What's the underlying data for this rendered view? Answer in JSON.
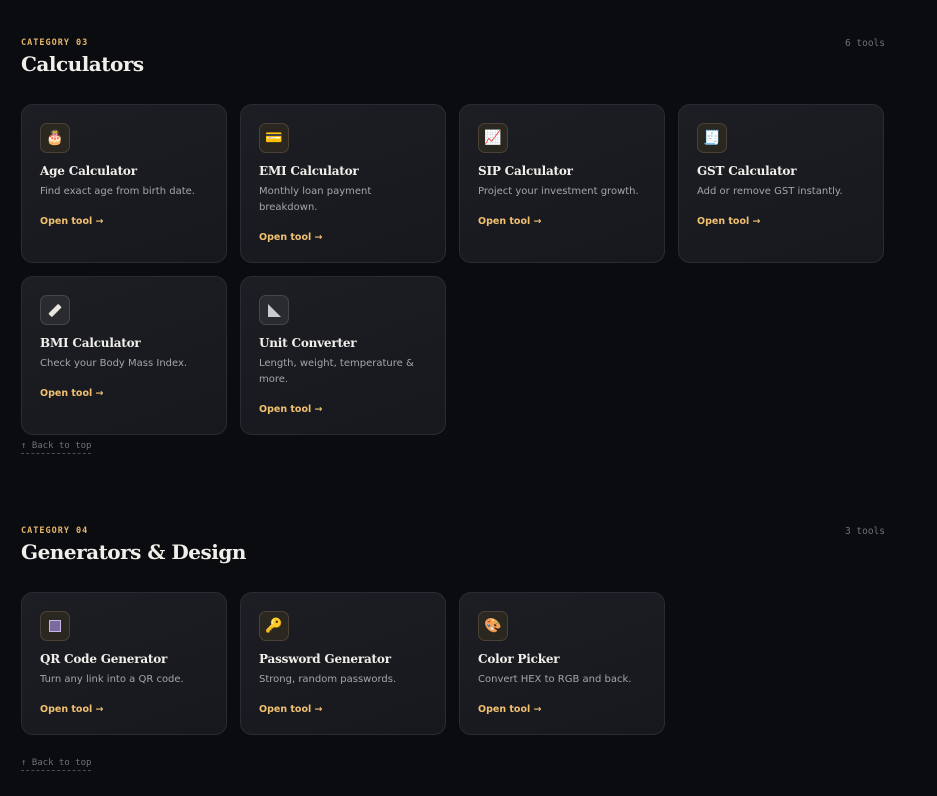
{
  "sections": [
    {
      "category": "CATEGORY 03",
      "count": "6 tools",
      "title": "Calculators",
      "back_label": "↑ Back to top",
      "cards": [
        {
          "title": "Age Calculator",
          "desc": "Find exact age from birth date.",
          "link": "Open tool →",
          "icon": "🎂",
          "icon_name": "birthday-cake-icon"
        },
        {
          "title": "EMI Calculator",
          "desc": "Monthly loan payment breakdown.",
          "link": "Open tool →",
          "icon": "💳",
          "icon_name": "credit-card-icon"
        },
        {
          "title": "SIP Calculator",
          "desc": "Project your investment growth.",
          "link": "Open tool →",
          "icon": "📈",
          "icon_name": "chart-up-icon"
        },
        {
          "title": "GST Calculator",
          "desc": "Add or remove GST instantly.",
          "link": "Open tool →",
          "icon": "🧾",
          "icon_name": "receipt-icon"
        },
        {
          "title": "BMI Calculator",
          "desc": "Check your Body Mass Index.",
          "link": "Open tool →",
          "icon": "",
          "icon_name": "ruler-icon"
        },
        {
          "title": "Unit Converter",
          "desc": "Length, weight, temperature & more.",
          "link": "Open tool →",
          "icon": "",
          "icon_name": "triangle-ruler-icon"
        }
      ]
    },
    {
      "category": "CATEGORY 04",
      "count": "3 tools",
      "title": "Generators & Design",
      "back_label": "↑ Back to top",
      "cards": [
        {
          "title": "QR Code Generator",
          "desc": "Turn any link into a QR code.",
          "link": "Open tool →",
          "icon": "",
          "icon_name": "qr-code-icon"
        },
        {
          "title": "Password Generator",
          "desc": "Strong, random passwords.",
          "link": "Open tool →",
          "icon": "🔑",
          "icon_name": "key-icon"
        },
        {
          "title": "Color Picker",
          "desc": "Convert HEX to RGB and back.",
          "link": "Open tool →",
          "icon": "🎨",
          "icon_name": "palette-icon"
        }
      ]
    }
  ],
  "colors": {
    "background": "#0b0c0f",
    "accent": "#f0c070",
    "card_border": "#2a2c33"
  }
}
